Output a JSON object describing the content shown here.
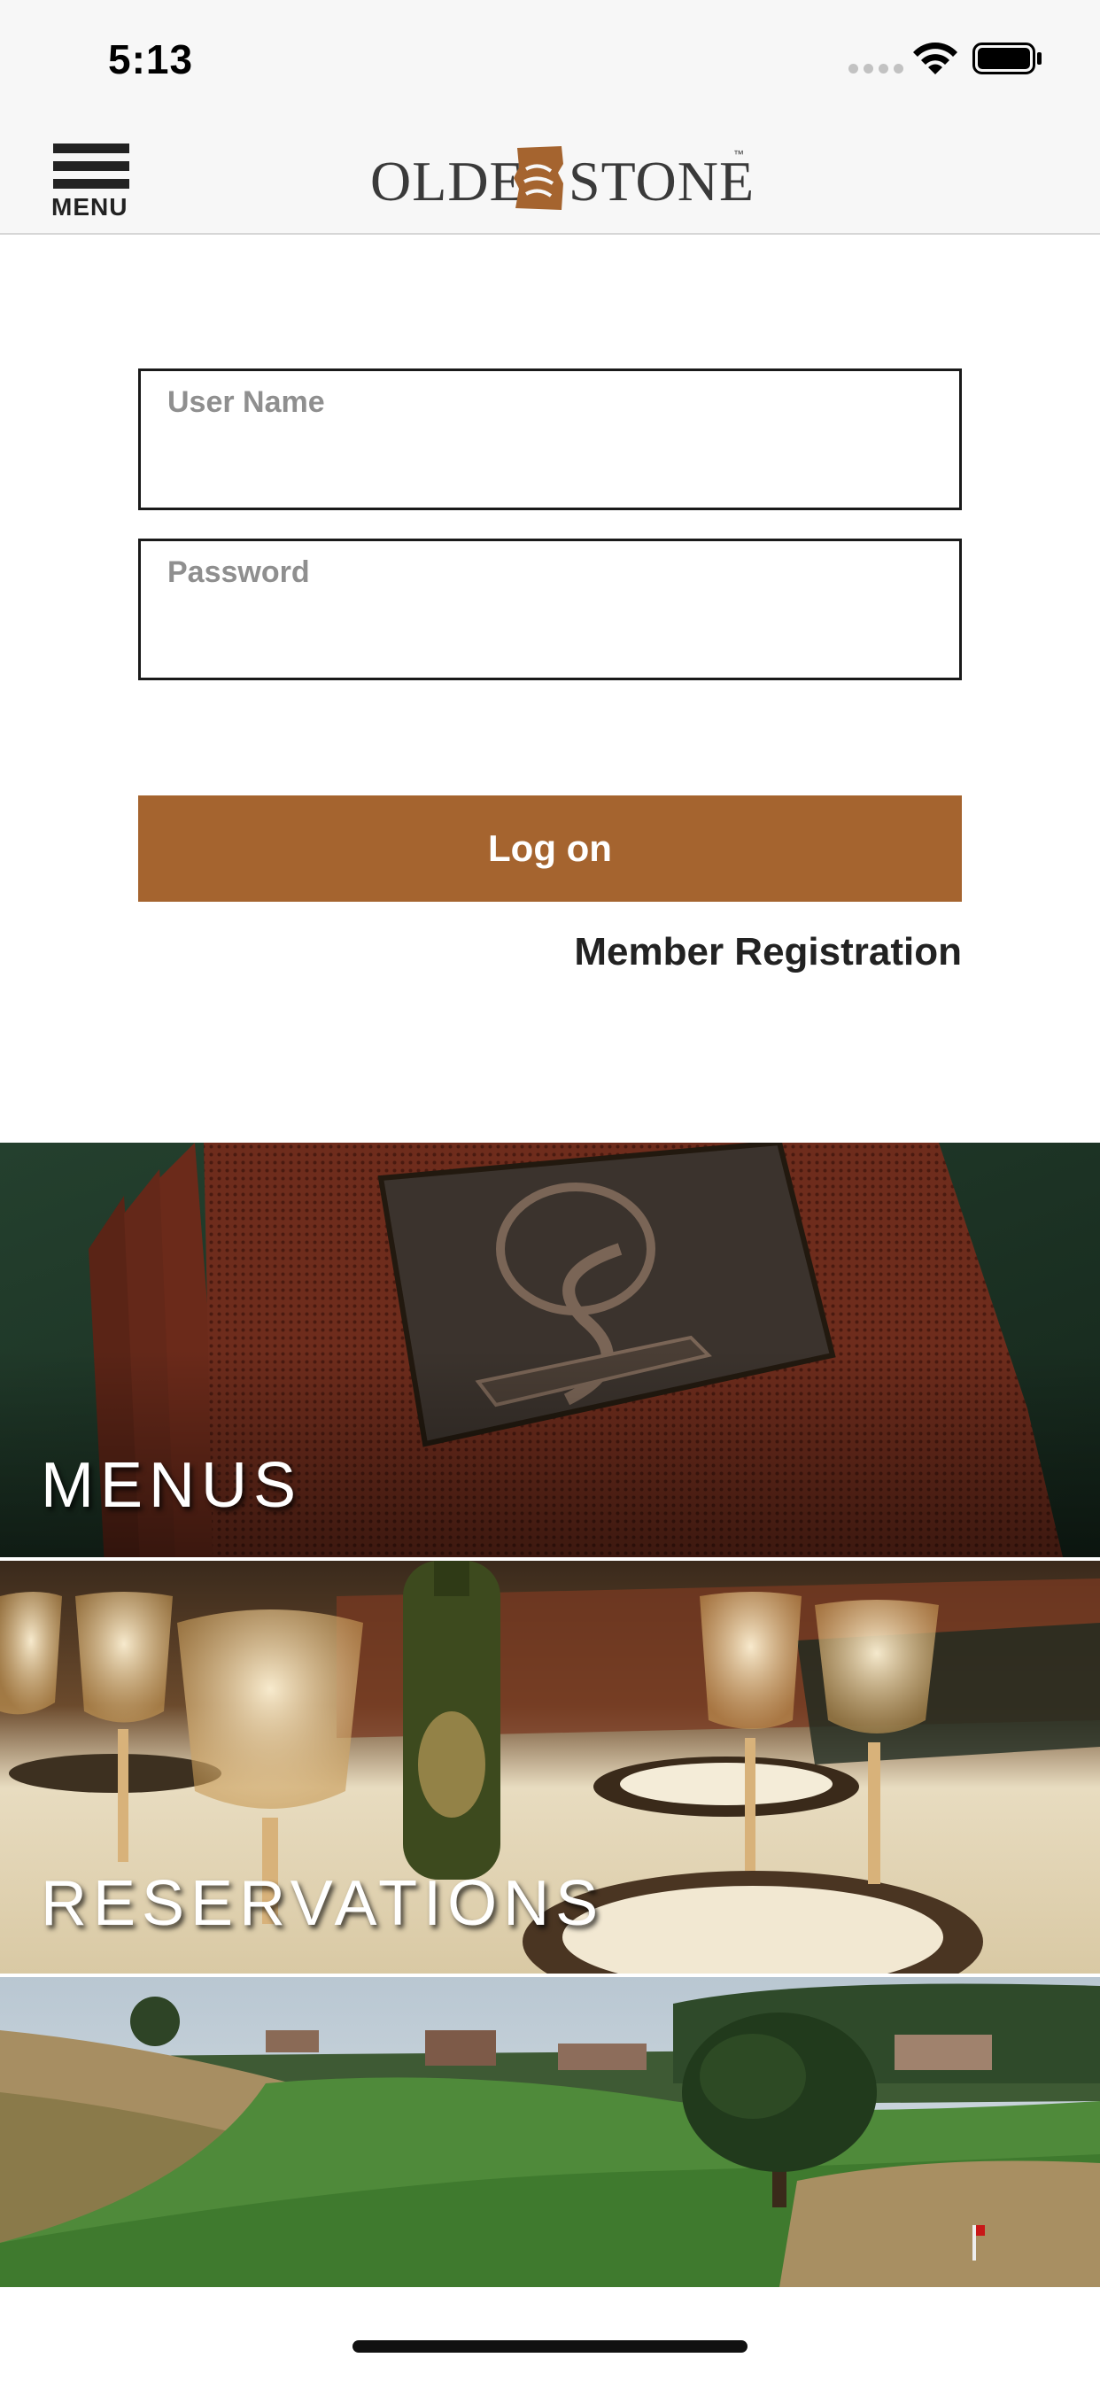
{
  "status_bar": {
    "time": "5:13",
    "icons": [
      "signal-dots-icon",
      "wifi-icon",
      "battery-icon"
    ]
  },
  "nav": {
    "menu_label": "MENU",
    "logo": {
      "left": "OLDE",
      "right": "STONE",
      "tm": "™"
    }
  },
  "login": {
    "username_label": "User Name",
    "username_value": "",
    "password_label": "Password",
    "password_value": "",
    "logon_label": "Log on",
    "registration_label": "Member Registration"
  },
  "banners": [
    {
      "label": "MENUS",
      "image": "leather-menu-with-club-logo"
    },
    {
      "label": "RESERVATIONS",
      "image": "dining-table-with-wine-glasses"
    },
    {
      "label": "",
      "image": "golf-course-fairway-with-oak-tree"
    }
  ],
  "colors": {
    "accent": "#a5642f",
    "bar_background": "#f7f7f7",
    "text_dark": "#222222",
    "label_gray": "#8f8f8f"
  }
}
